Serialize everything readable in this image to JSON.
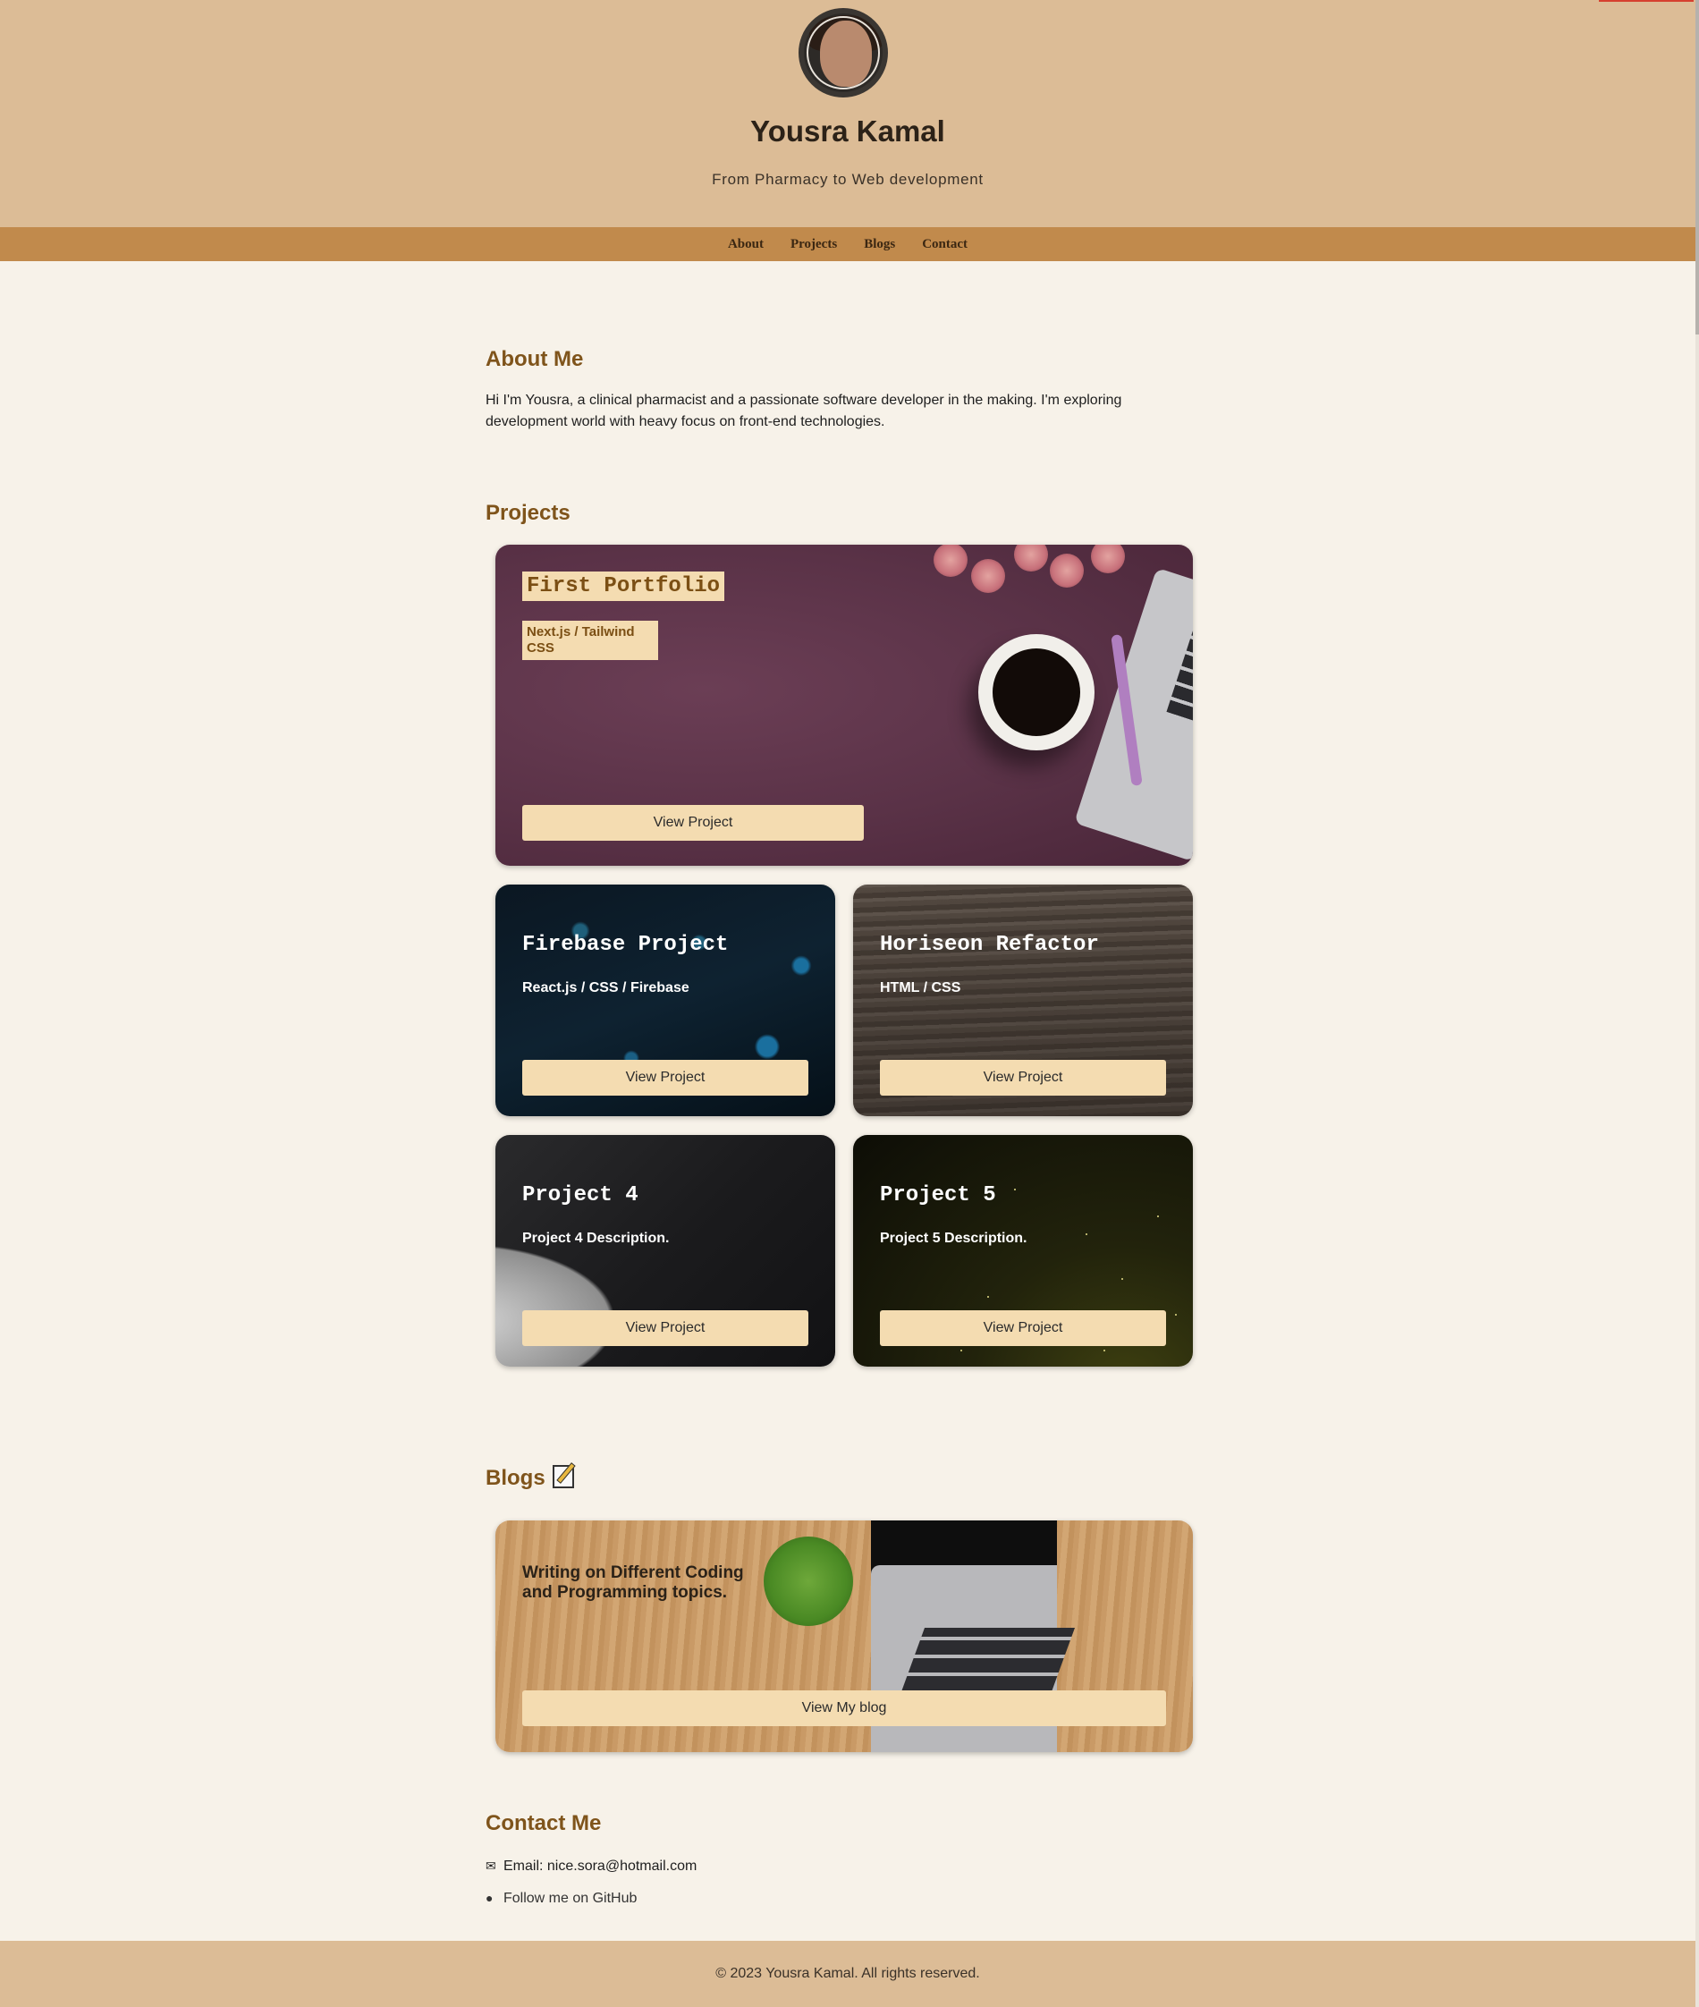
{
  "header": {
    "name": "Yousra Kamal",
    "tagline": "From Pharmacy to Web development"
  },
  "nav": {
    "items": [
      {
        "label": "About"
      },
      {
        "label": "Projects"
      },
      {
        "label": "Blogs"
      },
      {
        "label": "Contact"
      }
    ]
  },
  "about": {
    "title": "About Me",
    "text": "Hi I'm Yousra, a clinical pharmacist and a passionate software developer in the making. I'm exploring development world with heavy focus on front-end technologies."
  },
  "projects": {
    "title": "Projects",
    "items": [
      {
        "title": "First Portfolio",
        "desc": "Next.js / Tailwind CSS",
        "button": "View Project"
      },
      {
        "title": "Firebase Project",
        "desc": "React.js / CSS / Firebase",
        "button": "View Project"
      },
      {
        "title": "Horiseon Refactor",
        "desc": "HTML / CSS",
        "button": "View Project"
      },
      {
        "title": "Project 4",
        "desc": "Project 4 Description.",
        "button": "View Project"
      },
      {
        "title": "Project 5",
        "desc": "Project 5 Description.",
        "button": "View Project"
      }
    ]
  },
  "blogs": {
    "title": "Blogs",
    "icon": "memo-icon",
    "card": {
      "title": "Writing on Different Coding and Programming topics.",
      "button": "View My blog"
    }
  },
  "contact": {
    "title": "Contact Me",
    "email_label": "Email: nice.sora@hotmail.com",
    "github_label": "Follow me on GitHub",
    "email_icon": "envelope-icon",
    "github_icon": "github-icon"
  },
  "footer": {
    "text": "© 2023 Yousra Kamal. All rights reserved."
  },
  "colors": {
    "header_bg": "#dcbc96",
    "nav_bg": "#c18a4c",
    "page_bg": "#f7f2e9",
    "accent_title": "#7f541b",
    "button_bg": "#f4dcb1"
  }
}
